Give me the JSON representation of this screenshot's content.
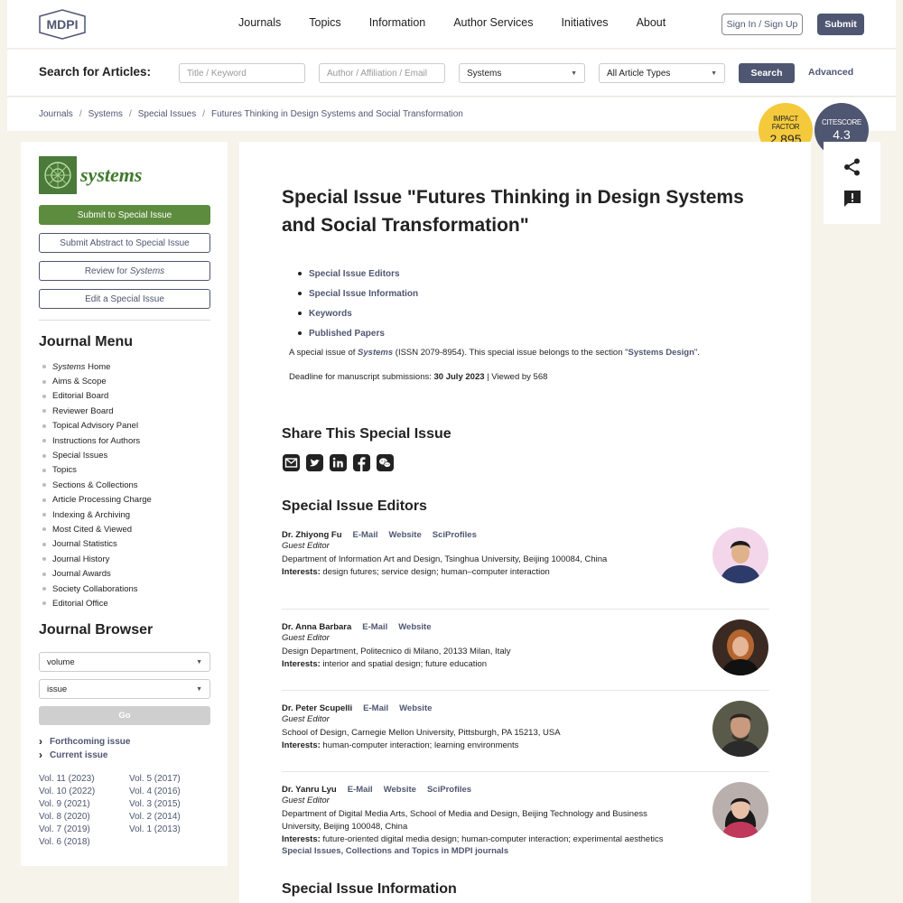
{
  "header": {
    "logo_text": "MDPI",
    "nav": [
      "Journals",
      "Topics",
      "Information",
      "Author Services",
      "Initiatives",
      "About"
    ],
    "signin": "Sign In / Sign Up",
    "submit": "Submit"
  },
  "search": {
    "label": "Search for Articles:",
    "keyword_placeholder": "Title / Keyword",
    "author_placeholder": "Author / Affiliation / Email",
    "journal_value": "Systems",
    "type_value": "All Article Types",
    "button": "Search",
    "advanced": "Advanced"
  },
  "breadcrumb": [
    "Journals",
    "Systems",
    "Special Issues",
    "Futures Thinking in Design Systems and Social Transformation"
  ],
  "metrics": {
    "if_label1": "IMPACT",
    "if_label2": "FACTOR",
    "if_value": "2.895",
    "cs_label": "CITESCORE",
    "cs_value": "4.3"
  },
  "sidebar": {
    "journal_name": "systems",
    "buttons": {
      "submit_si": "Submit to Special Issue",
      "submit_abstract": "Submit Abstract to Special Issue",
      "review_prefix": "Review for ",
      "review_journal": "Systems",
      "edit_si": "Edit a Special Issue"
    },
    "menu_title": "Journal Menu",
    "menu_first_italic": "Systems",
    "menu_first_rest": " Home",
    "menu": [
      "Aims & Scope",
      "Editorial Board",
      "Reviewer Board",
      "Topical Advisory Panel",
      "Instructions for Authors",
      "Special Issues",
      "Topics",
      "Sections & Collections",
      "Article Processing Charge",
      "Indexing & Archiving",
      "Most Cited & Viewed",
      "Journal Statistics",
      "Journal History",
      "Journal Awards",
      "Society Collaborations",
      "Editorial Office"
    ],
    "browser_title": "Journal Browser",
    "volume_select": "volume",
    "issue_select": "issue",
    "go": "Go",
    "forthcoming": "Forthcoming issue",
    "current": "Current issue",
    "vols_col1": [
      "Vol. 11 (2023)",
      "Vol. 10 (2022)",
      "Vol. 9 (2021)",
      "Vol. 8 (2020)",
      "Vol. 7 (2019)",
      "Vol. 6 (2018)"
    ],
    "vols_col2": [
      "Vol. 5 (2017)",
      "Vol. 4 (2016)",
      "Vol. 3 (2015)",
      "Vol. 2 (2014)",
      "Vol. 1 (2013)"
    ]
  },
  "main": {
    "title": "Special Issue \"Futures Thinking in Design Systems and Social Transformation\"",
    "toc": [
      "Special Issue Editors",
      "Special Issue Information",
      "Keywords",
      "Published Papers"
    ],
    "desc_1": "A special issue of ",
    "desc_journal": "Systems",
    "desc_2": " (ISSN 2079-8954). This special issue belongs to the section \"",
    "desc_section": "Systems Design",
    "desc_3": "\".",
    "deadline_label": "Deadline for manuscript submissions: ",
    "deadline_date": "30 July 2023",
    "viewed": " | Viewed by 568",
    "share_title": "Share This Special Issue",
    "editors_title": "Special Issue Editors",
    "info_title": "Special Issue Information",
    "editors": [
      {
        "name": "Dr. Zhiyong Fu",
        "links": [
          "E-Mail",
          "Website",
          "SciProfiles"
        ],
        "role": "Guest Editor",
        "affiliation": "Department of Information Art and Design, Tsinghua University, Beijing 100084, China",
        "interests_label": "Interests:",
        "interests": " design futures; service design; human–computer interaction"
      },
      {
        "name": "Dr. Anna Barbara",
        "links": [
          "E-Mail",
          "Website"
        ],
        "role": "Guest Editor",
        "affiliation": "Design Department, Politecnico di Milano, 20133 Milan, Italy",
        "interests_label": "Interests:",
        "interests": " interior and spatial design; future education"
      },
      {
        "name": "Dr. Peter Scupelli",
        "links": [
          "E-Mail",
          "Website"
        ],
        "role": "Guest Editor",
        "affiliation": "School of Design, Carnegie Mellon University, Pittsburgh, PA 15213, USA",
        "interests_label": "Interests:",
        "interests": " human-computer interaction; learning environments"
      },
      {
        "name": "Dr. Yanru Lyu",
        "links": [
          "E-Mail",
          "Website",
          "SciProfiles"
        ],
        "role": "Guest Editor",
        "affiliation": "Department of Digital Media Arts, School of Media and Design, Beijing Technology and Business University, Beijing 100048, China",
        "interests_label": "Interests:",
        "interests": " future-oriented digital media design; human-computer interaction; experimental aesthetics",
        "extra_link": "Special Issues, Collections and Topics in MDPI journals"
      }
    ]
  },
  "colors": {
    "brand": "#4f5671",
    "journal_green": "#5d8c3e",
    "impact_yellow": "#f4ca3c",
    "background": "#f6f3ea"
  },
  "icons": [
    "mdpi-logo-icon",
    "caret-down-icon",
    "chevron-right-icon",
    "email-icon",
    "twitter-icon",
    "linkedin-icon",
    "facebook-icon",
    "wechat-icon",
    "share-icon",
    "feedback-icon",
    "avatar"
  ]
}
